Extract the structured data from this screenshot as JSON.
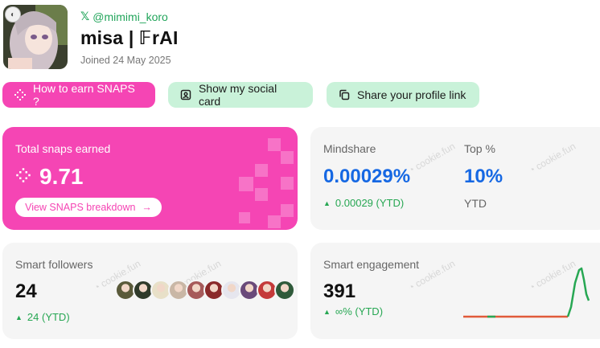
{
  "profile": {
    "handle": "@mimimi_koro",
    "name": "misa | 𝔽rAI",
    "joined": "Joined 24 May 2025"
  },
  "actions": {
    "earn_label": "How to earn SNAPS ?",
    "social_label": "Show my social card",
    "share_label": "Share your profile link"
  },
  "snaps": {
    "label": "Total snaps earned",
    "value": "9.71",
    "breakdown_label": "View SNAPS breakdown"
  },
  "mindshare": {
    "label": "Mindshare",
    "value": "0.00029%",
    "change": "0.00029 (YTD)",
    "top_label": "Top %",
    "top_value": "10%",
    "top_period": "YTD"
  },
  "followers": {
    "label": "Smart followers",
    "value": "24",
    "change": "24 (YTD)",
    "avatar_colors": [
      "#5a5a3a",
      "#2f3a2a",
      "#e8e0c8",
      "#c9b7a6",
      "#a65a5a",
      "#8a2a2a",
      "#e6e6ee",
      "#6a4a7a",
      "#c43a3a",
      "#2f5a3a"
    ]
  },
  "engagement": {
    "label": "Smart engagement",
    "value": "391",
    "change": "∞% (YTD)"
  },
  "watermark": "cookie.fun",
  "colors": {
    "pink": "#f545b4",
    "green": "#27a753",
    "blue": "#1668e3",
    "mint": "#c9f2d9"
  }
}
